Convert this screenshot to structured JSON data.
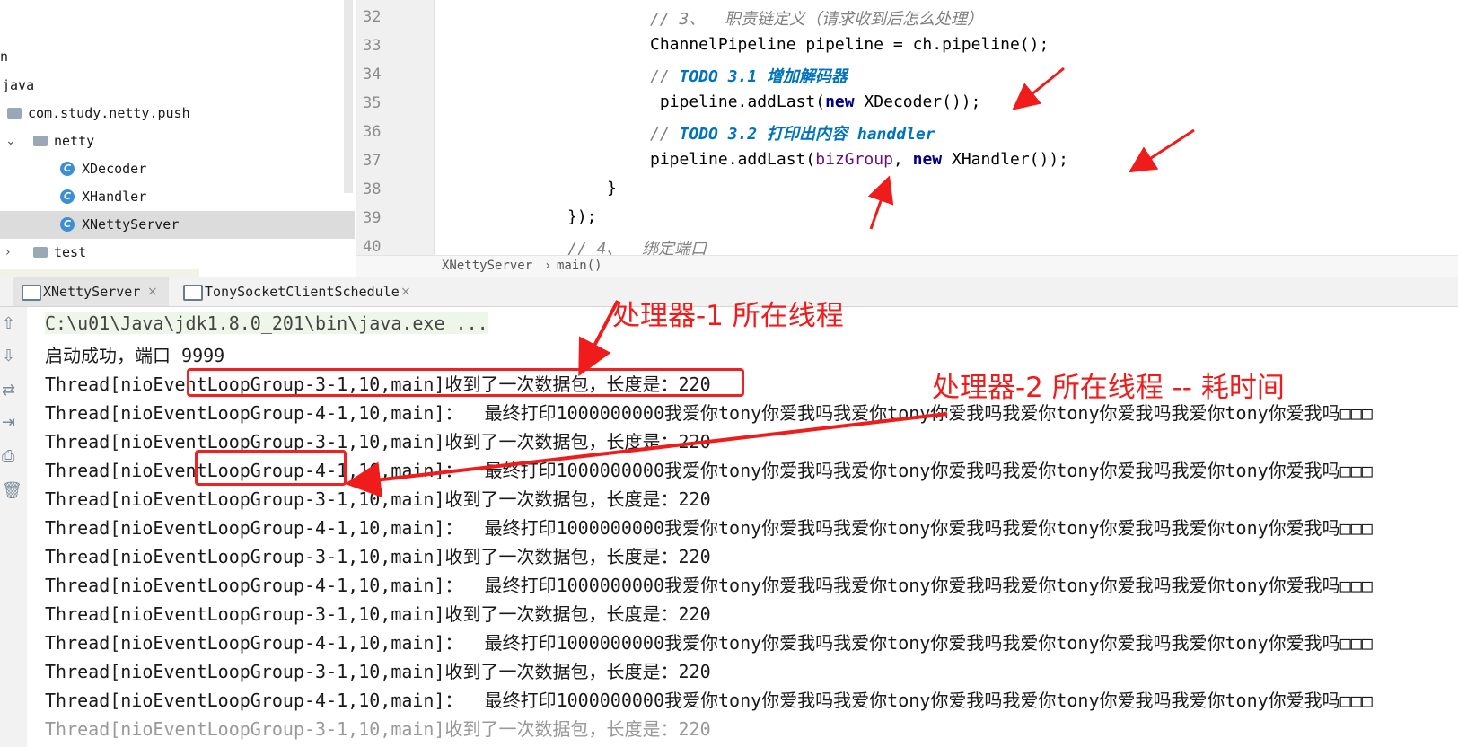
{
  "project_tree": {
    "items": [
      {
        "label": "n"
      },
      {
        "label": "java"
      },
      {
        "label": "com.study.netty.push"
      },
      {
        "label": "netty"
      },
      {
        "label": "XDecoder"
      },
      {
        "label": "XHandler"
      },
      {
        "label": "XNettyServer"
      },
      {
        "label": "test"
      }
    ],
    "class_badge": "C"
  },
  "editor": {
    "line_numbers": [
      "32",
      "33",
      "34",
      "35",
      "36",
      "37",
      "38",
      "39",
      "40"
    ],
    "lines": {
      "l32": "// 3、  职责链定义（请求收到后怎么处理）",
      "l33": "ChannelPipeline pipeline = ch.pipeline();",
      "l34_prefix": "// ",
      "l34_todo": "TODO 3.1 增加解码器",
      "l35_a": " pipeline.addLast(",
      "l35_kw": "new",
      "l35_b": " XDecoder());",
      "l36_prefix": "// ",
      "l36_todo": "TODO 3.2 打印出内容 handdler",
      "l37_a": "pipeline.addLast(",
      "l37_field": "bizGroup",
      "l37_b": ", ",
      "l37_kw": "new",
      "l37_c": " XHandler());",
      "l38": "}",
      "l39": "});",
      "l40": "// 4、  绑定端口"
    },
    "breadcrumb": [
      "XNettyServer",
      "main()"
    ],
    "breadcrumb_sep": "›"
  },
  "run_tabs": [
    {
      "label": "XNettyServer",
      "active": true,
      "close": "×"
    },
    {
      "label": "TonySocketClientSchedule",
      "active": false,
      "close": "×"
    }
  ],
  "console": {
    "lines": [
      "C:\\u01\\Java\\jdk1.8.0_201\\bin\\java.exe ...",
      "启动成功，端口 9999",
      "Thread[nioEventLoopGroup-3-1,10,main]收到了一次数据包，长度是：220",
      "Thread[nioEventLoopGroup-4-1,10,main]：  最终打印1000000000我爱你tony你爱我吗我爱你tony你爱我吗我爱你tony你爱我吗我爱你tony你爱我吗□□□",
      "Thread[nioEventLoopGroup-3-1,10,main]收到了一次数据包，长度是：220",
      "Thread[nioEventLoopGroup-4-1,10,main]：  最终打印1000000000我爱你tony你爱我吗我爱你tony你爱我吗我爱你tony你爱我吗我爱你tony你爱我吗□□□",
      "Thread[nioEventLoopGroup-3-1,10,main]收到了一次数据包，长度是：220",
      "Thread[nioEventLoopGroup-4-1,10,main]：  最终打印1000000000我爱你tony你爱我吗我爱你tony你爱我吗我爱你tony你爱我吗我爱你tony你爱我吗□□□",
      "Thread[nioEventLoopGroup-3-1,10,main]收到了一次数据包，长度是：220",
      "Thread[nioEventLoopGroup-4-1,10,main]：  最终打印1000000000我爱你tony你爱我吗我爱你tony你爱我吗我爱你tony你爱我吗我爱你tony你爱我吗□□□",
      "Thread[nioEventLoopGroup-3-1,10,main]收到了一次数据包，长度是：220",
      "Thread[nioEventLoopGroup-4-1,10,main]：  最终打印1000000000我爱你tony你爱我吗我爱你tony你爱我吗我爱你tony你爱我吗我爱你tony你爱我吗□□□",
      "Thread[nioEventLoopGroup-3-1,10,main]收到了一次数据包，长度是：220",
      "Thread[nioEventLoopGroup-4-1,10,main]：  最终打印1000000000我爱你tony你爱我吗我爱你tony你爱我吗我爱你tony你爱我吗我爱你tony你爱我吗□□□",
      "Thread[nioEventLoopGroup-3-1,10,main]收到了一次数据包，长度是：220"
    ],
    "toolbar_icons": [
      "up-arrow-icon",
      "down-arrow-icon",
      "soft-wrap-icon",
      "scroll-to-end-icon",
      "print-icon",
      "trash-icon"
    ]
  },
  "annotations": {
    "label_1": "处理器-1 所在线程",
    "label_2": "处理器-2 所在线程 -- 耗时间",
    "color": "#f01c1c"
  }
}
